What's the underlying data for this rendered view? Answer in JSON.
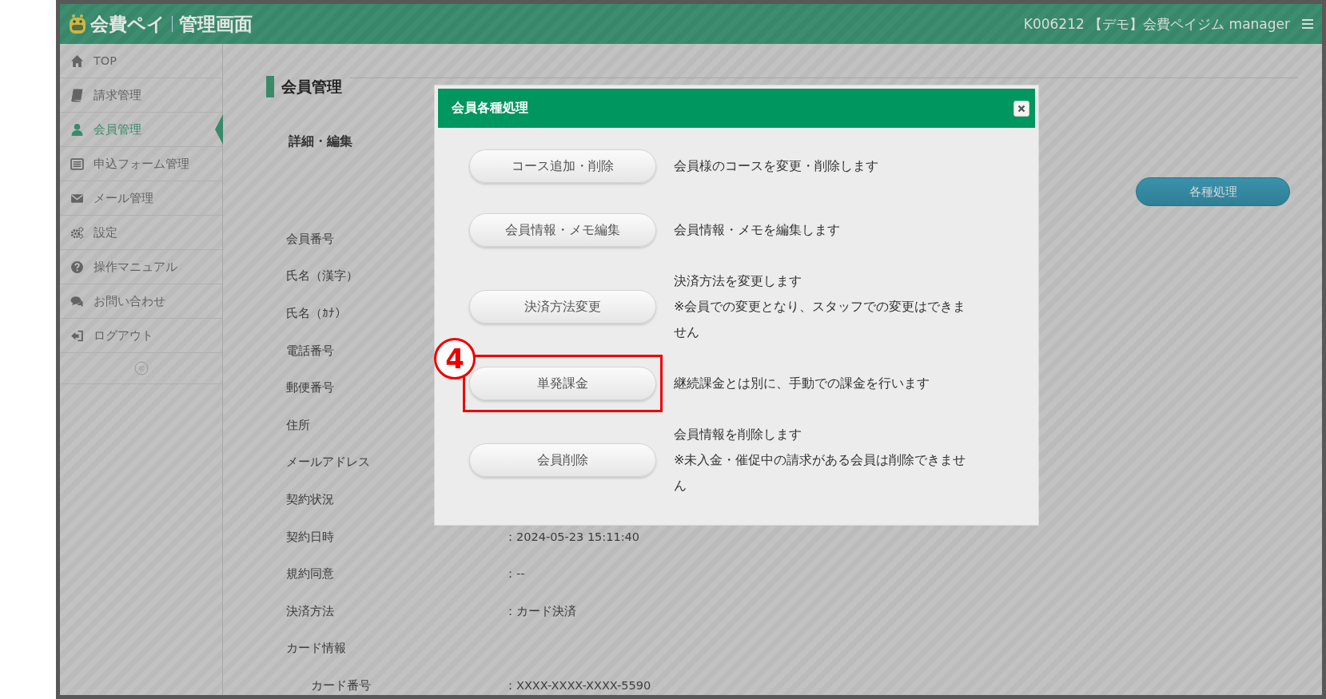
{
  "header": {
    "logo": "会費ペイ",
    "subtitle": "管理画面",
    "account": "K006212 【デモ】会費ペイジム manager"
  },
  "sidebar": {
    "items": [
      {
        "label": "TOP",
        "selected": false
      },
      {
        "label": "請求管理",
        "selected": false
      },
      {
        "label": "会員管理",
        "selected": true
      },
      {
        "label": "申込フォーム管理",
        "selected": false
      },
      {
        "label": "メール管理",
        "selected": false
      },
      {
        "label": "設定",
        "selected": false
      },
      {
        "label": "操作マニュアル",
        "selected": false
      },
      {
        "label": "お問い合わせ",
        "selected": false
      },
      {
        "label": "ログアウト",
        "selected": false
      }
    ]
  },
  "page": {
    "title": "会員管理",
    "section": "詳細・編集",
    "action_button": "各種処理",
    "fields": [
      {
        "label": "会員番号",
        "kind": "main"
      },
      {
        "label": "氏名（漢字）",
        "kind": "main"
      },
      {
        "label": "氏名（ｶﾅ）",
        "kind": "main"
      },
      {
        "label": "電話番号",
        "kind": "main"
      },
      {
        "label": "郵便番号",
        "kind": "main"
      },
      {
        "label": "住所",
        "kind": "main"
      },
      {
        "label": "メールアドレス",
        "kind": "main"
      },
      {
        "label": "契約状況",
        "kind": "main"
      },
      {
        "label": "契約日時",
        "value": "：2024-05-23 15:11:40",
        "kind": "main"
      },
      {
        "label": "規約同意",
        "value": "：--",
        "kind": "main"
      },
      {
        "label": "決済方法",
        "value": "：カード決済",
        "kind": "main"
      },
      {
        "label": "カード情報",
        "kind": "main"
      },
      {
        "label": "カード番号",
        "value": "：XXXX-XXXX-XXXX-5590",
        "kind": "sub"
      }
    ]
  },
  "modal": {
    "title": "会員各種処理",
    "annotation": "4",
    "actions": [
      {
        "label": "コース追加・削除",
        "description": [
          "会員様のコースを変更・削除します"
        ],
        "highlighted": false
      },
      {
        "label": "会員情報・メモ編集",
        "description": [
          "会員情報・メモを編集します"
        ],
        "highlighted": false
      },
      {
        "label": "決済方法変更",
        "description": [
          "決済方法を変更します",
          "※会員での変更となり、スタッフでの変更はできません"
        ],
        "highlighted": false
      },
      {
        "label": "単発課金",
        "description": [
          "継続課金とは別に、手動での課金を行います"
        ],
        "highlighted": true
      },
      {
        "label": "会員削除",
        "description": [
          "会員情報を削除します",
          "※未入金・催促中の請求がある会員は削除できません"
        ],
        "highlighted": false
      }
    ]
  }
}
